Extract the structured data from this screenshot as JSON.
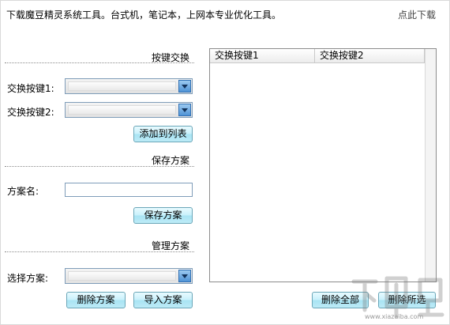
{
  "header": {
    "description": "下载魔豆精灵系统工具。台式机，笔记本，上网本专业优化工具。",
    "download_link": "点此下载"
  },
  "key_swap": {
    "title": "按键交换",
    "key1_label": "交换按键1:",
    "key2_label": "交换按键2:",
    "key1_value": "",
    "key2_value": "",
    "add_button": "添加到列表"
  },
  "save_scheme": {
    "title": "保存方案",
    "name_label": "方案名:",
    "name_value": "",
    "save_button": "保存方案"
  },
  "manage_scheme": {
    "title": "管理方案",
    "select_label": "选择方案:",
    "select_value": "",
    "delete_button": "删除方案",
    "import_button": "导入方案"
  },
  "swap_list": {
    "columns": [
      "交换按键1",
      "交换按键2"
    ],
    "rows": [],
    "delete_all_button": "删除全部",
    "delete_selected_button": "删除所选"
  },
  "watermark": {
    "text": "下载吧",
    "url": "www.xiazaiba.com"
  }
}
